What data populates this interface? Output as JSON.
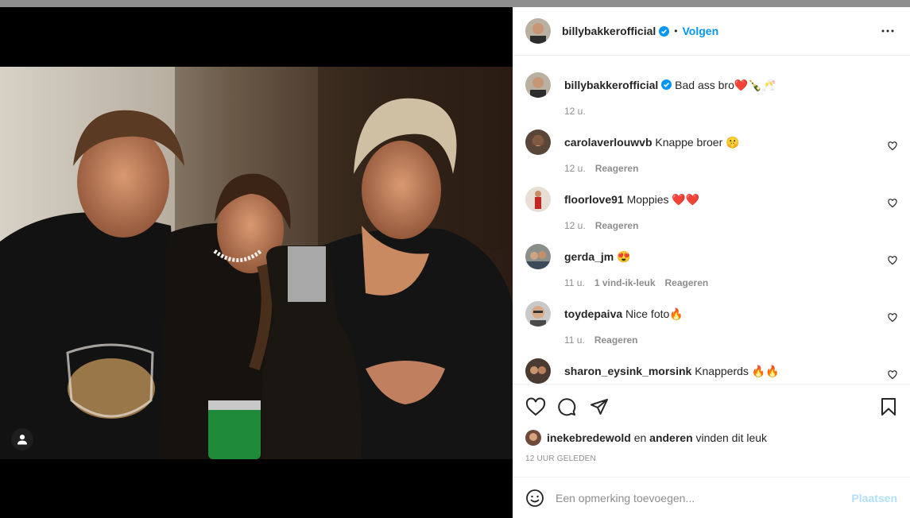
{
  "post": {
    "username": "billybakkerofficial",
    "verified": true,
    "follow_label": "Volgen",
    "separator": "•",
    "more_icon": "more-horizontal-icon"
  },
  "caption": {
    "username": "billybakkerofficial",
    "text": "Bad ass bro❤️🍾🥂",
    "time": "12 u."
  },
  "comments": [
    {
      "username": "carolaverlouwvb",
      "text": "Knappe broer 🤫",
      "time": "12 u.",
      "likes": "",
      "reply": "Reageren"
    },
    {
      "username": "floorlove91",
      "text": "Moppies ❤️❤️",
      "time": "12 u.",
      "likes": "",
      "reply": "Reageren"
    },
    {
      "username": "gerda_jm",
      "text": "😍",
      "time": "11 u.",
      "likes": "1 vind-ik-leuk",
      "reply": "Reageren"
    },
    {
      "username": "toydepaiva",
      "text": "Nice foto🔥",
      "time": "11 u.",
      "likes": "",
      "reply": "Reageren"
    },
    {
      "username": "sharon_eysink_morsink",
      "text": "Knapperds 🔥🔥",
      "time": "",
      "likes": "",
      "reply": ""
    }
  ],
  "likes": {
    "user": "inekebredewold",
    "connector": "en",
    "others": "anderen",
    "suffix": "vinden dit leuk"
  },
  "timestamp": "12 UUR GELEDEN",
  "add_comment": {
    "placeholder": "Een opmerking toevoegen...",
    "post_label": "Plaatsen"
  },
  "colors": {
    "accent": "#0095f6",
    "accent_disabled": "#b2dffc",
    "secondary_text": "#8e8e8e",
    "border": "#efefef"
  }
}
